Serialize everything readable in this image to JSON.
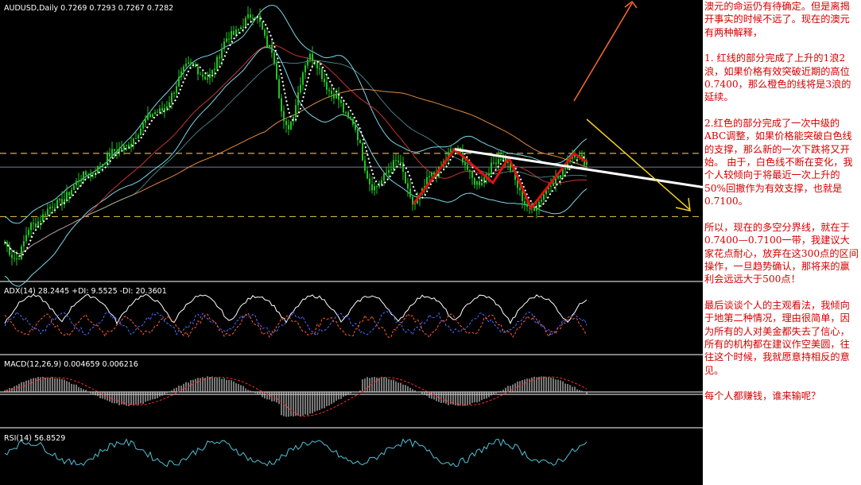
{
  "main_panel": {
    "symbol_header": "AUDUSD,Daily  0.7269 0.7293 0.7267 0.7282"
  },
  "adx_panel": {
    "header": "ADX(14) 28.2445 +DI: 9.5525 -DI: 20.3601"
  },
  "macd_panel": {
    "header": "MACD(12,26,9)  0.004659  0.006216"
  },
  "rsi_panel": {
    "header": "RSI(14)  56.8529"
  },
  "commentary": {
    "p1": "澳元的命运仍有待确定。但是离揭开事实的时候不远了。现在的澳元有两种解释，",
    "p2": "1. 红线的部分完成了上升的1浪2浪，如果价格有效突破近期的高位0.7400，那么橙色的线将是3浪的延续。",
    "p3": "2.红色的部分完成了一次中级的ABC调整，如果价格能突破白色线的支撑，那么新的一次下跌将又开始。 由于，白色线不断在变化，我个人较倾向于将最近一次上升的50%回撤作为有效支撑，也就是0.7100。",
    "p4": "所以，现在的多空分界线，就在于0.7400—0.7100一带，我建议大家花点耐心，放弃在这300点的区间操作，一旦趋势确认，那将来的赢利会远远大于500点！",
    "p5": "最后谈谈个人的主观看法，我倾向于地第二种情况，理由很简单，因为所有的人对美金都失去了信心，所有的机构都在建议作空美圆，往往这个时候，我就愿意持相反的意见。",
    "p6": "每个人都赚钱，谁来输呢？"
  },
  "colors": {
    "background": "#000000",
    "candles": "#22c422",
    "bollinger": "#7ad8e8",
    "dotted_ma": "#ffffff",
    "ma_red": "#c83232",
    "ma_slow": "#e08a40",
    "red_wave": "#e01010",
    "white_trend": "#ffffff",
    "orange_arrow": "#ff6a2a",
    "yellow_arrow": "#f0d020",
    "hlines": "#d2b040",
    "commentary_text": "#d40000"
  },
  "chart_data": {
    "type": "line",
    "instrument": "AUDUSD",
    "timeframe": "Daily",
    "ohlc_last": {
      "open": 0.7269,
      "high": 0.7293,
      "low": 0.7267,
      "close": 0.7282
    },
    "price_path_anchors": [
      [
        0,
        0.7
      ],
      [
        20,
        0.69
      ],
      [
        40,
        0.706
      ],
      [
        70,
        0.716
      ],
      [
        110,
        0.73
      ],
      [
        150,
        0.742
      ],
      [
        200,
        0.76
      ],
      [
        240,
        0.782
      ],
      [
        260,
        0.776
      ],
      [
        290,
        0.796
      ],
      [
        320,
        0.806
      ],
      [
        340,
        0.79
      ],
      [
        360,
        0.752
      ],
      [
        390,
        0.786
      ],
      [
        420,
        0.768
      ],
      [
        440,
        0.756
      ],
      [
        470,
        0.724
      ],
      [
        500,
        0.736
      ],
      [
        520,
        0.716
      ],
      [
        545,
        0.73
      ],
      [
        572,
        0.742
      ],
      [
        600,
        0.726
      ],
      [
        630,
        0.738
      ],
      [
        668,
        0.714
      ],
      [
        700,
        0.728
      ],
      [
        722,
        0.74
      ],
      [
        738,
        0.736
      ]
    ],
    "abc_red_line": [
      [
        520,
        0.716
      ],
      [
        572,
        0.742
      ],
      [
        620,
        0.726
      ],
      [
        640,
        0.738
      ],
      [
        668,
        0.714
      ],
      [
        722,
        0.74
      ],
      [
        738,
        0.736
      ]
    ],
    "white_trendline": [
      [
        572,
        0.742
      ],
      [
        884,
        0.724
      ]
    ],
    "horizontal_levels": [
      0.74,
      0.71
    ],
    "price_range": [
      0.68,
      0.812
    ],
    "adx": {
      "adx": 28.2445,
      "plus_di": 9.5525,
      "minus_di": 20.3601
    },
    "macd": {
      "main": 0.004659,
      "signal": 0.006216
    },
    "rsi": 56.8529
  }
}
